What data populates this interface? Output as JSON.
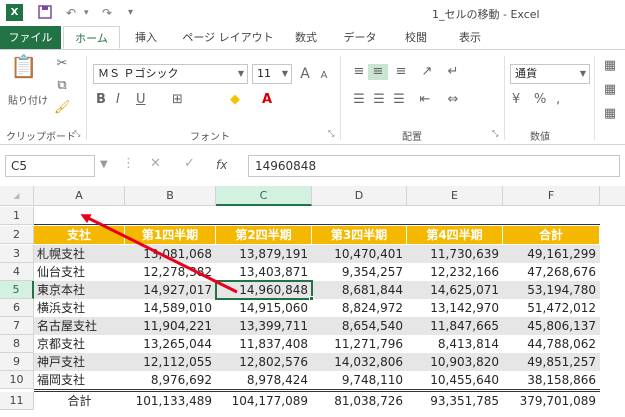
{
  "window": {
    "title": "1_セルの移動 - Excel",
    "app_icon": "excel-icon",
    "save_icon": "save-icon",
    "undo_icon": "undo-icon",
    "redo_icon": "redo-icon",
    "qat_more": "▾"
  },
  "tabs": [
    {
      "label": "ファイル"
    },
    {
      "label": "ホーム"
    },
    {
      "label": "挿入"
    },
    {
      "label": "ページ レイアウト"
    },
    {
      "label": "数式"
    },
    {
      "label": "データ"
    },
    {
      "label": "校閲"
    },
    {
      "label": "表示"
    }
  ],
  "ribbon": {
    "clipboard": {
      "label": "クリップボード",
      "paste_label": "貼り付け"
    },
    "font": {
      "label": "フォント",
      "font_name": "ＭＳ Ｐゴシック",
      "font_size": "11",
      "grow": "A",
      "shrink": "A"
    },
    "alignment": {
      "label": "配置"
    },
    "number": {
      "label": "数値",
      "format": "通貨"
    }
  },
  "formula_bar": {
    "name_box": "C5",
    "fx": "fx",
    "value": "14960848"
  },
  "columns": [
    "A",
    "B",
    "C",
    "D",
    "E",
    "F"
  ],
  "rows": [
    "1",
    "2",
    "3",
    "4",
    "5",
    "6",
    "7",
    "8",
    "9",
    "10",
    "11"
  ],
  "table": {
    "headers": [
      "支社",
      "第1四半期",
      "第2四半期",
      "第3四半期",
      "第4四半期",
      "合計"
    ],
    "body": [
      [
        "札幌支社",
        "13,081,068",
        "13,879,191",
        "10,470,401",
        "11,730,639",
        "49,161,299"
      ],
      [
        "仙台支社",
        "12,278,382",
        "13,403,871",
        "9,354,257",
        "12,232,166",
        "47,268,676"
      ],
      [
        "東京本社",
        "14,927,017",
        "14,960,848",
        "8,681,844",
        "14,625,071",
        "53,194,780"
      ],
      [
        "横浜支社",
        "14,589,010",
        "14,915,060",
        "8,824,972",
        "13,142,970",
        "51,472,012"
      ],
      [
        "名古屋支社",
        "11,904,221",
        "13,399,711",
        "8,654,540",
        "11,847,665",
        "45,806,137"
      ],
      [
        "京都支社",
        "13,265,044",
        "11,837,408",
        "11,271,796",
        "8,413,814",
        "44,788,062"
      ],
      [
        "神戸支社",
        "12,112,055",
        "12,802,576",
        "14,032,806",
        "10,903,820",
        "49,851,257"
      ],
      [
        "福岡支社",
        "8,976,692",
        "8,978,424",
        "9,748,110",
        "10,455,640",
        "38,158,866"
      ]
    ],
    "total": [
      "合計",
      "101,133,489",
      "104,177,089",
      "81,038,726",
      "93,351,785",
      "379,701,089"
    ]
  },
  "colors": {
    "accent": "#217346",
    "header_fill": "#f5b800",
    "band_fill": "#e6e6e6",
    "arrow": "#e8001c"
  }
}
